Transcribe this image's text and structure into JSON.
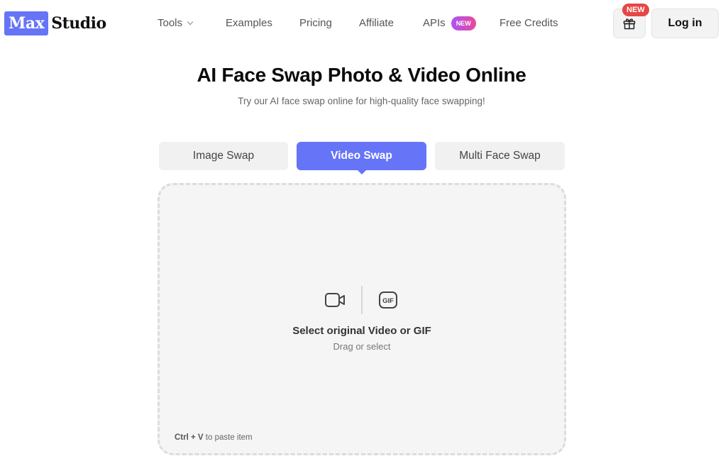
{
  "brand": {
    "logo_box": "Max",
    "logo_text": "Studio",
    "accent": "#6674f8"
  },
  "nav": {
    "tools": "Tools",
    "examples": "Examples",
    "pricing": "Pricing",
    "affiliate": "Affiliate",
    "apis": "APIs",
    "apis_badge": "NEW",
    "free_credits": "Free Credits"
  },
  "header": {
    "gift_badge": "NEW",
    "login": "Log in"
  },
  "hero": {
    "title": "AI Face Swap Photo & Video Online",
    "subtitle": "Try our AI face swap online for high-quality face swapping!"
  },
  "tabs": [
    {
      "label": "Image Swap",
      "active": false
    },
    {
      "label": "Video Swap",
      "active": true
    },
    {
      "label": "Multi Face Swap",
      "active": false
    }
  ],
  "upload": {
    "icons": [
      "video-camera-icon",
      "gif-icon"
    ],
    "title": "Select original Video or GIF",
    "subtitle": "Drag or select",
    "paste_shortcut": "Ctrl + V",
    "paste_text": "to paste item"
  }
}
